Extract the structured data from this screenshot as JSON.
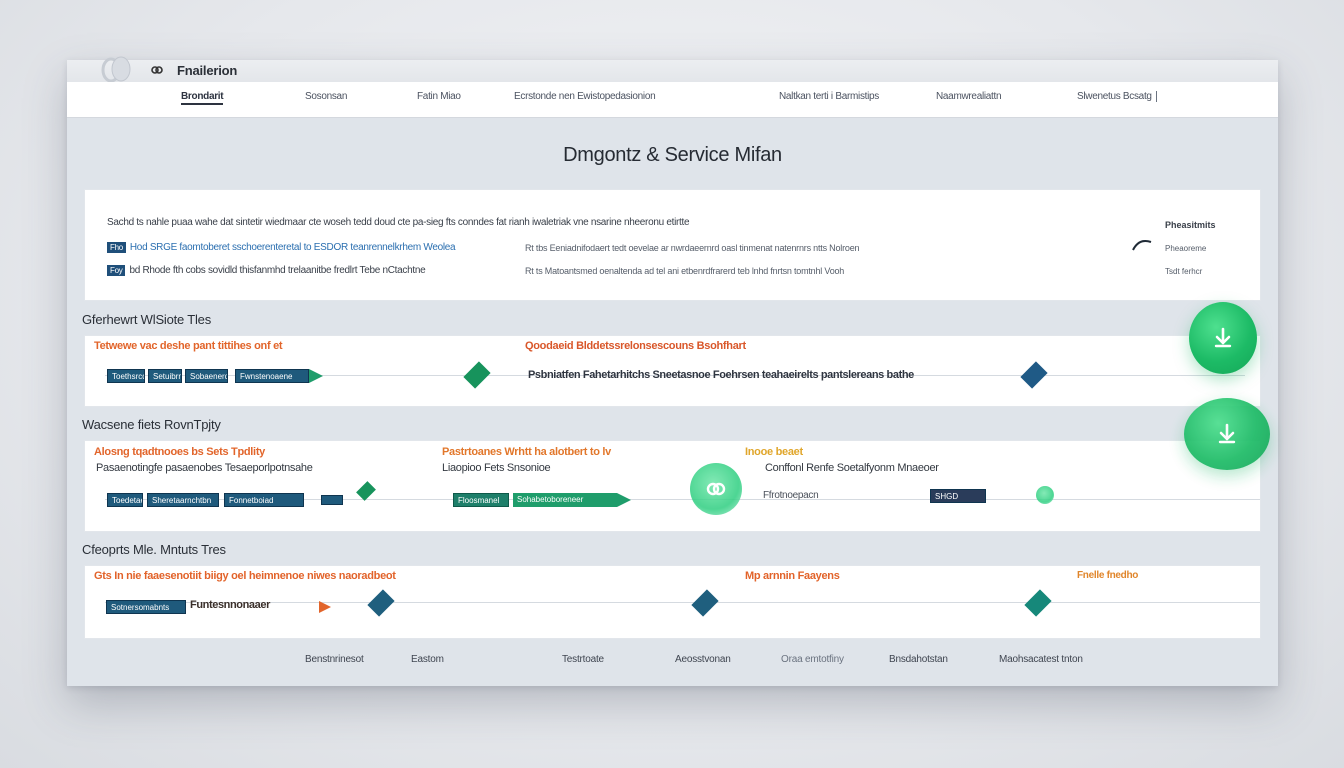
{
  "app": {
    "title": "Fnailerion"
  },
  "nav": {
    "items": [
      {
        "label": "Brondarit"
      },
      {
        "label": "Sosonsan"
      },
      {
        "label": "Fatin Miao"
      },
      {
        "label": "Ecrstonde nen Ewistopedasionion"
      },
      {
        "label": "Naltkan terti i Barmistips"
      },
      {
        "label": "Naamwrealiattn"
      },
      {
        "label": "Slwenetus Bcsatg"
      }
    ]
  },
  "page": {
    "title": "Dmgontz & Service Mifan"
  },
  "summary": {
    "header": "Sachd ts nahle puaa wahe dat sintetir wiedmaar  cte woseh tedd doud  cte pa-sieg fts conndes fat rianh iwaletriak vne nsarine nheeronu etirtte",
    "header_right": "Pheasitmits",
    "rows": [
      {
        "tag": "Fho",
        "left_blue": "Hod  SRGE  faomtoberet sschoerenteretal  to  ESDOR  teanrennelkrhem  Weolea",
        "mid": "Rt tbs Eeniadnifodaert  tedt oevelae ar nwrdaeernrd oasl tinmenat natenrnrs  ntts  Nolroen",
        "right": "Pheaoreme"
      },
      {
        "tag": "Foy",
        "left_dark": "bd Rhode fth  cobs sovidld thisfanmhd trelaanitbe fredlrt Tebe nCtachtne",
        "mid": "Rt ts Matoantsmed  oenaltenda  ad tel ani  etbenrdfrarerd teb lnhd  fnrtsn  tomtnhl  Vooh",
        "right": "Tsdt ferhcr"
      }
    ]
  },
  "sections": [
    {
      "label": "Gferhewrt WlSiote Tles",
      "headline_left": "Tetwewe vac deshe pant tittihes onf et",
      "headline_mid": "Qoodaeid Blddetssrelonsescouns Bsohfhart",
      "chips": [
        "Toethsrcd",
        "Setuibrns",
        "Sobaenerd",
        "Fwnstenoaene"
      ],
      "mid_text": "Psbniatfen Fahetarhitchs Sneetasnoe Foehrsen teahaeirelts pantslereans bathe"
    },
    {
      "label": "Wacsene fiets RovnTpjty",
      "headline_left": "Alosng  tqadtnooes bs Sets Tpdlity",
      "sub_left": "Pasaenotingfe pasaenobes Tesaeporlpotnsahe",
      "headline_mid": "Pastrtoanes Wrhtt ha alotbert to lv",
      "sub_mid": "Liaopioo Fets Snsonioe",
      "headline_right": "Inooe beaet",
      "sub_right": "Conffonl Renfe Soetalfyonm Mnaeoer",
      "chips_left": [
        "Toedetaernd",
        "Sheretaarnchtbn",
        "Fonnetboiad"
      ],
      "chips_mid": [
        "Floosmanel",
        "Sohabetoboreneer"
      ],
      "bubble_label": "Ffrotnoepacn",
      "tag_label": "SHGD"
    },
    {
      "label": "Cfeoprts Mle. Mntuts Tres",
      "headline_left": "Gts In nie  faaesenotiit biigy oel heimnenoe niwes naoradbeot",
      "headline_mid": "Mp arnnin Faayens",
      "headline_right": "Fnelle fnedho",
      "chip": "Sotnersomabnts",
      "arrow_text": "Funtesnnonaaer"
    }
  ],
  "footer": {
    "items": [
      {
        "label": "Benstnrinesot"
      },
      {
        "label": "Eastom"
      },
      {
        "label": "Testrtoate"
      },
      {
        "label": "Aeosstvonan"
      },
      {
        "label": "Oraa emtotfiny"
      },
      {
        "label": "Bnsdahotstan"
      },
      {
        "label": "Maohsacatest tnton"
      }
    ]
  },
  "colors": {
    "accent_orange": "#e2652b",
    "accent_green": "#1dbb66",
    "chip_navy": "#1f5a7c",
    "link_blue": "#2b6fb0"
  }
}
